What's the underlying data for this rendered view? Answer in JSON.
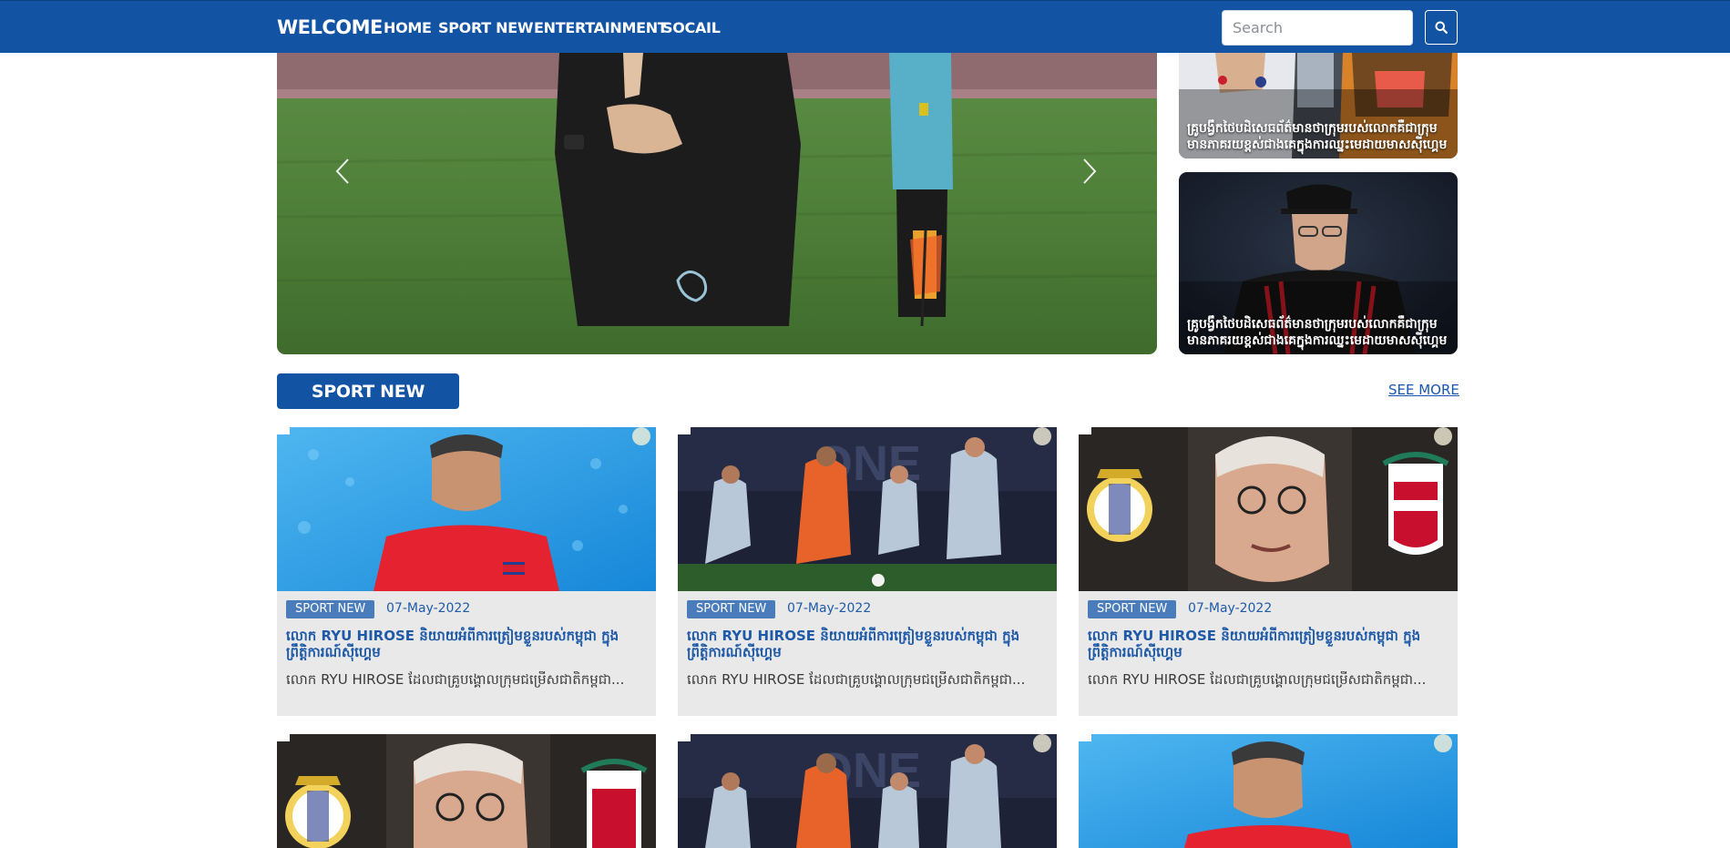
{
  "nav": {
    "brand": "WELCOME",
    "links": [
      "HOME",
      "SPORT NEW",
      "ENTERTAINMENT",
      "SOCAIL"
    ],
    "search_placeholder": "Search",
    "search_icon": "search-icon"
  },
  "hero": {
    "prev_icon": "chevron-left-icon",
    "next_icon": "chevron-right-icon"
  },
  "side_cards": [
    {
      "title": "គ្រូបង្វឹកថៃបដិសេធព័ត៌មានថាក្រុមរបស់លោកគឺជាក្រុមមានភាគរយខ្ពស់ជាងគេក្នុងការឈ្នះមេដាយមាសស៊ីហ្គេម"
    },
    {
      "title": "គ្រូបង្វឹកថៃបដិសេធព័ត៌មានថាក្រុមរបស់លោកគឺជាក្រុមមានភាគរយខ្ពស់ជាងគេក្នុងការឈ្នះមេដាយមាសស៊ីហ្គេម"
    }
  ],
  "section": {
    "title": "SPORT NEW",
    "see_more": "SEE MORE"
  },
  "cards": [
    {
      "tag": "SPORT NEW",
      "date": "07-May-2022",
      "title": "លោក RYU HIROSE និយាយអំពីការត្រៀមខ្លួនរបស់កម្ពុជា ក្នុងព្រឹត្តិការណ៍ស៊ីហ្គេម",
      "excerpt": "លោក RYU HIROSE ដែលជាគ្រូបង្គោលក្រុមជម្រើសជាតិកម្ពុជា..."
    },
    {
      "tag": "SPORT NEW",
      "date": "07-May-2022",
      "title": "លោក RYU HIROSE និយាយអំពីការត្រៀមខ្លួនរបស់កម្ពុជា ក្នុងព្រឹត្តិការណ៍ស៊ីហ្គេម",
      "excerpt": "លោក RYU HIROSE ដែលជាគ្រូបង្គោលក្រុមជម្រើសជាតិកម្ពុជា..."
    },
    {
      "tag": "SPORT NEW",
      "date": "07-May-2022",
      "title": "លោក RYU HIROSE និយាយអំពីការត្រៀមខ្លួនរបស់កម្ពុជា ក្នុងព្រឹត្តិការណ៍ស៊ីហ្គេម",
      "excerpt": "លោក RYU HIROSE ដែលជាគ្រូបង្គោលក្រុមជម្រើសជាតិកម្ពុជា..."
    }
  ],
  "colors": {
    "brand_blue": "#1253a4",
    "tag_blue": "#4a7cbc",
    "link_blue": "#1a56b3",
    "card_bg": "#e9e9e9"
  }
}
